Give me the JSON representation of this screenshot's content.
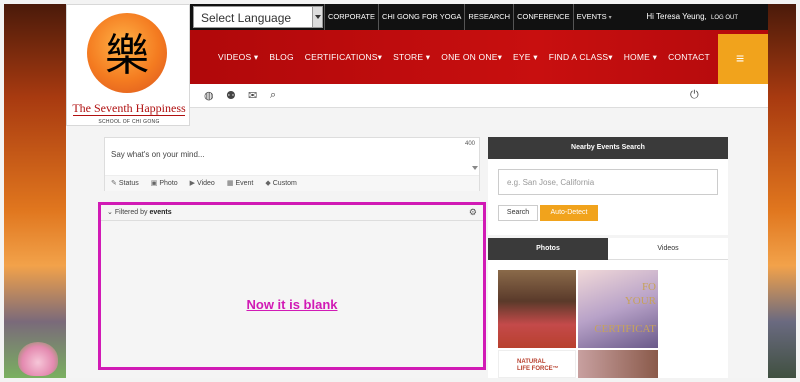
{
  "logo": {
    "glyph": "樂",
    "title": "The Seventh Happiness",
    "subtitle": "SCHOOL OF CHI GONG"
  },
  "topbar": {
    "language_select": "Select Language",
    "links": [
      "CORPORATE",
      "CHI GONG FOR YOGA",
      "RESEARCH",
      "CONFERENCE",
      "EVENTS"
    ],
    "greeting": "Hi Teresa Yeung,",
    "logout": "LOG OUT"
  },
  "nav": {
    "items": [
      "VIDEOS ▾",
      "BLOG",
      "CERTIFICATIONS▾",
      "STORE ▾",
      "ONE ON ONE▾",
      "EYE ▾",
      "FIND A CLASS▾",
      "HOME ▾",
      "CONTACT"
    ],
    "menu_icon": "hamburger-icon"
  },
  "toolbar": {
    "icons": [
      "globe-icon",
      "users-icon",
      "mail-icon",
      "search-icon",
      "power-icon"
    ]
  },
  "status": {
    "placeholder": "Say what's on your mind...",
    "char_count": "400",
    "options": [
      {
        "icon": "✎",
        "label": "Status"
      },
      {
        "icon": "▣",
        "label": "Photo"
      },
      {
        "icon": "▶",
        "label": "Video"
      },
      {
        "icon": "▦",
        "label": "Event"
      },
      {
        "icon": "◆",
        "label": "Custom"
      }
    ]
  },
  "filter": {
    "prefix": "Filtered by",
    "value": "events",
    "blank_note": "Now it is blank"
  },
  "nearby": {
    "title": "Nearby Events Search",
    "placeholder": "e.g. San Jose, California",
    "search_label": "Search",
    "auto_label": "Auto-Detect"
  },
  "media_tabs": {
    "photos": "Photos",
    "videos": "Videos"
  },
  "photo_texts": {
    "p2": "FO\nYOUR\n\nCERTIFICAT",
    "p3": "NATURAL\nLIFE FORCE™"
  },
  "colors": {
    "accent": "#f1a31c",
    "nav_red": "#c80f0f",
    "highlight": "#d11ab5"
  }
}
